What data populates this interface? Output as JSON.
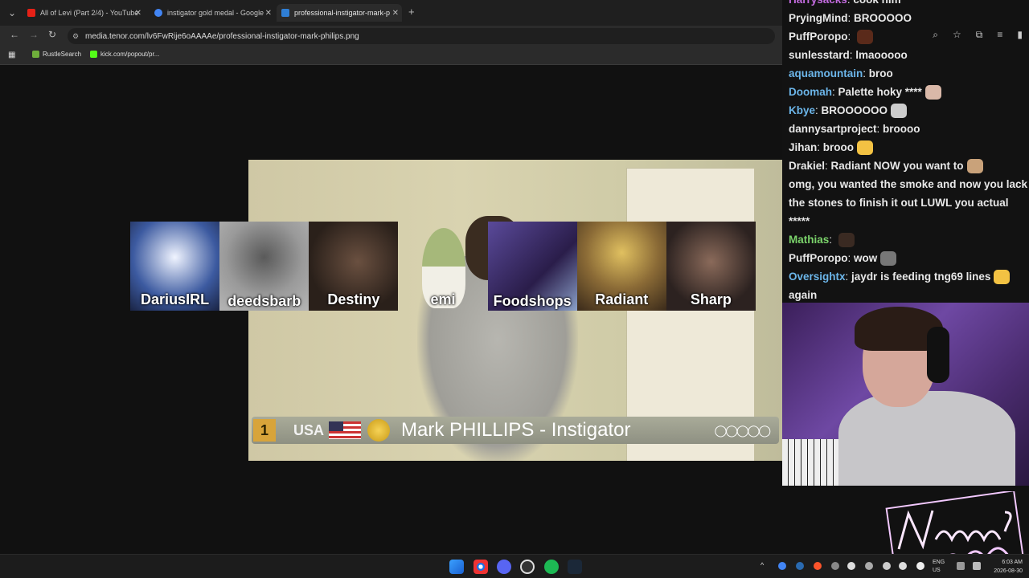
{
  "browser": {
    "tabs": [
      {
        "title": "All of Levi (Part 2/4) - YouTube",
        "favicon_color": "#e62117"
      },
      {
        "title": "instigator gold medal - Google",
        "favicon_color": "#4285f4"
      },
      {
        "title": "professional-instigator-mark-p",
        "favicon_color": "#2f7fd6"
      }
    ],
    "new_tab_label": "+",
    "url": "media.tenor.com/lv6FwRije6oAAAAe/professional-instigator-mark-philips.png",
    "bookmarks": [
      {
        "label": "RustleSearch",
        "color": "#6fae3b"
      },
      {
        "label": "kick.com/popout/pr...",
        "color": "#53fc18"
      }
    ]
  },
  "meme": {
    "rank": "1",
    "country": "USA",
    "athlete": "Mark PHILLIPS - Instigator"
  },
  "tiles": [
    {
      "name": "DariusIRL",
      "bg": "#2a3b6a"
    },
    {
      "name": "deedsbarb",
      "bg": "#9a9a9a"
    },
    {
      "name": "Destiny",
      "bg": "#3a2d24"
    },
    {
      "name": "emi",
      "bg": "#121212"
    },
    {
      "name": "Foodshops",
      "bg": "#4a3a7a"
    },
    {
      "name": "Radiant",
      "bg": "#6a4e2c"
    },
    {
      "name": "Sharp",
      "bg": "#2c2220"
    }
  ],
  "chat": [
    {
      "user": "Harrysacks",
      "text": "cook him",
      "color": "#c36bdf"
    },
    {
      "user": "PryingMind",
      "text": "BROOOOO",
      "color": "#e8e8e8"
    },
    {
      "user": "PuffPoropo",
      "text": "",
      "color": "#e8e8e8",
      "emote": "#5a2a1a"
    },
    {
      "user": "sunlesstard",
      "text": "lmaooooo",
      "color": "#e8e8e8"
    },
    {
      "user": "aquamountain",
      "text": "broo",
      "color": "#6cb6ea"
    },
    {
      "user": "Doomah",
      "text": "Palette hoky ****",
      "color": "#6cb6ea",
      "emote": "#d9b8a8"
    },
    {
      "user": "Kbye",
      "text": "BROOOOOO",
      "color": "#6cb6ea",
      "emote": "#cccccc"
    },
    {
      "user": "dannysartproject",
      "text": "broooo",
      "color": "#e8e8e8"
    },
    {
      "user": "Jihan",
      "text": "brooo",
      "color": "#e8e8e8",
      "emote": "#f3c243"
    },
    {
      "user": "Drakiel",
      "text": "Radiant NOW you want to",
      "color": "#e8e8e8",
      "emote": "#c9a27a"
    },
    {
      "user": "",
      "text": "omg, you wanted the smoke and now you lack",
      "color": "#e8e8e8"
    },
    {
      "user": "",
      "text": "the stones to finish it out LUWL you actual",
      "color": "#e8e8e8"
    },
    {
      "user": "",
      "text": "*****",
      "color": "#e8e8e8"
    },
    {
      "user": "Mathias",
      "text": "",
      "color": "#7bd36b",
      "emote": "#3a2a22"
    },
    {
      "user": "PuffPoropo",
      "text": "wow",
      "color": "#e8e8e8",
      "emote": "#777777"
    },
    {
      "user": "Oversightx",
      "text": "jaydr is feeding tng69 lines",
      "color": "#6cb6ea",
      "emote": "#f3c243"
    },
    {
      "user": "",
      "text": "again",
      "color": "#e8e8e8"
    }
  ],
  "logo_text": "Nothing Else?",
  "taskbar": {
    "lang": "ENG",
    "region": "US",
    "time": "6:03 AM",
    "date": "2026-08-30"
  }
}
